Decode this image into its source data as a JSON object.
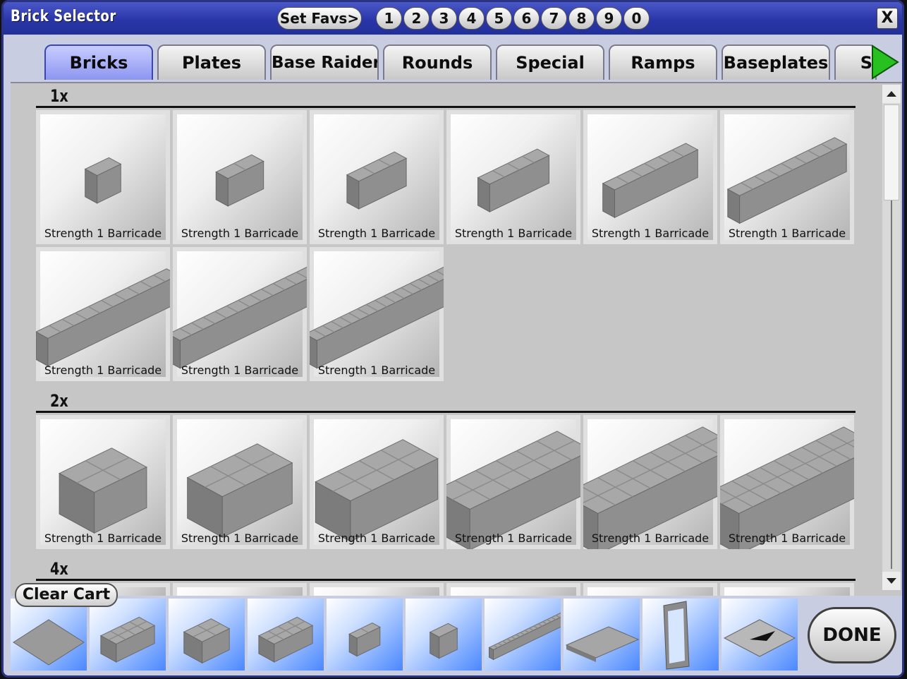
{
  "window": {
    "title": "Brick Selector",
    "close_label": "X"
  },
  "favorites": {
    "set_label": "Set Favs>",
    "slots": [
      "1",
      "2",
      "3",
      "4",
      "5",
      "6",
      "7",
      "8",
      "9",
      "0"
    ]
  },
  "tabs": [
    "Bricks",
    "Plates",
    "Base Raiders",
    "Rounds",
    "Special",
    "Ramps",
    "Baseplates",
    "S"
  ],
  "active_tab": "Bricks",
  "sections": [
    {
      "label": "1x",
      "bricks": [
        {
          "caption": "Strength 1 Barricade",
          "studs": 1,
          "depth": 1
        },
        {
          "caption": "Strength 1 Barricade",
          "studs": 2,
          "depth": 1
        },
        {
          "caption": "Strength 1 Barricade",
          "studs": 3,
          "depth": 1
        },
        {
          "caption": "Strength 1 Barricade",
          "studs": 4,
          "depth": 1
        },
        {
          "caption": "Strength 1 Barricade",
          "studs": 6,
          "depth": 1
        },
        {
          "caption": "Strength 1 Barricade",
          "studs": 8,
          "depth": 1
        },
        {
          "caption": "Strength 1 Barricade",
          "studs": 10,
          "depth": 1
        },
        {
          "caption": "Strength 1 Barricade",
          "studs": 12,
          "depth": 1
        },
        {
          "caption": "Strength 1 Barricade",
          "studs": 16,
          "depth": 1
        }
      ]
    },
    {
      "label": "2x",
      "bricks": [
        {
          "caption": "Strength 1 Barricade",
          "studs": 2,
          "depth": 2
        },
        {
          "caption": "Strength 1 Barricade",
          "studs": 3,
          "depth": 2
        },
        {
          "caption": "Strength 1 Barricade",
          "studs": 4,
          "depth": 2
        },
        {
          "caption": "Strength 1 Barricade",
          "studs": 6,
          "depth": 2
        },
        {
          "caption": "Strength 1 Barricade",
          "studs": 8,
          "depth": 2
        },
        {
          "caption": "Strength 1 Barricade",
          "studs": 10,
          "depth": 2
        }
      ]
    },
    {
      "label": "4x",
      "bricks": []
    }
  ],
  "cart": {
    "clear_label": "Clear Cart",
    "items": [
      "baseplate-icon",
      "brick-2x4-icon",
      "brick-2x2-icon",
      "brick-2x4-icon",
      "brick-1x2-icon",
      "brick-1x1-icon",
      "brick-1x16-icon",
      "plate-grid-icon",
      "window-frame-icon",
      "ramp-arrow-icon"
    ]
  },
  "done_label": "DONE",
  "colors": {
    "title_bar": "#2a36a8",
    "active_tab": "#8c96f0",
    "cart_item": "#4a88ff",
    "next_arrow": "#28c020"
  }
}
